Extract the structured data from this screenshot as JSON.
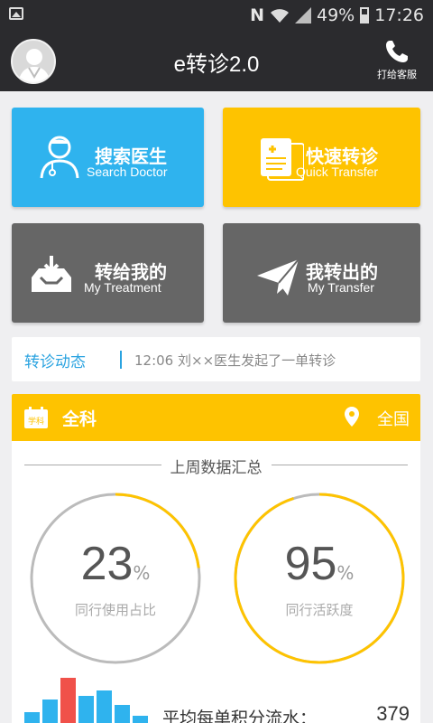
{
  "status_bar": {
    "notification_icon": "image-icon",
    "n_label": "N",
    "battery": "49%",
    "time": "17:26"
  },
  "header": {
    "title": "e转诊2.0",
    "service_label": "打给客服",
    "service_icon": "phone-icon",
    "avatar_icon": "doctor-avatar-icon"
  },
  "tiles": [
    {
      "cn": "搜索医生",
      "en": "Search Doctor",
      "icon": "doctor-icon",
      "color": "#2fb3ee"
    },
    {
      "cn": "快速转诊",
      "en": "Quick Transfer",
      "icon": "document-icon",
      "color": "#fec300"
    },
    {
      "cn": "转给我的",
      "en": "My Treatment",
      "icon": "inbox-icon",
      "color": "#666666"
    },
    {
      "cn": "我转出的",
      "en": "My Transfer",
      "icon": "paper-plane-icon",
      "color": "#666666"
    }
  ],
  "news": {
    "title": "转诊动态",
    "text": "12:06 刘××医生发起了一单转诊"
  },
  "stats": {
    "department": "全科",
    "department_icon_text": "学科",
    "location": "全国",
    "summary_title": "上周数据汇总",
    "gauges": [
      {
        "value": "23",
        "unit": "%",
        "label": "同行使用占比",
        "fraction": 0.23
      },
      {
        "value": "95",
        "unit": "%",
        "label": "同行活跃度",
        "fraction": 0.95
      }
    ],
    "points_label": "平均每单积分流水：",
    "points_value": "379"
  },
  "colors": {
    "accent_yellow": "#fec300",
    "accent_blue": "#2fb3ee",
    "gauge_track": "#bbbbbb",
    "bar_red": "#f0514a"
  }
}
